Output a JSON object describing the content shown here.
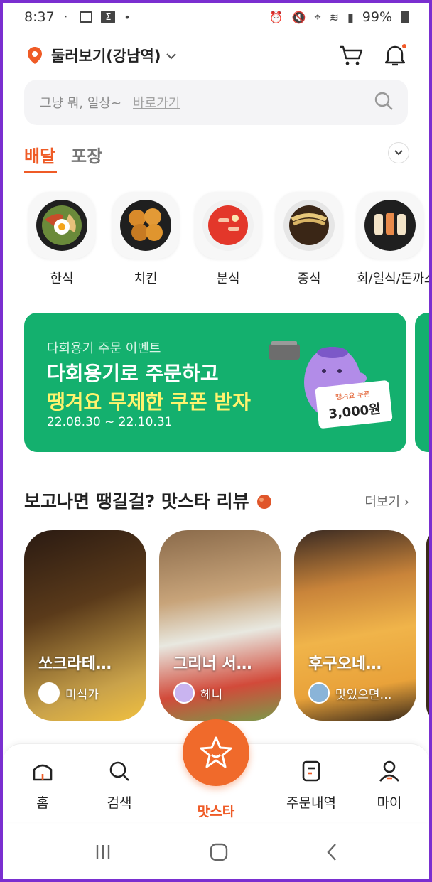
{
  "status_bar": {
    "time": "8:37",
    "battery": "99%"
  },
  "header": {
    "location": "둘러보기(강남역)"
  },
  "search": {
    "placeholder": "그냥 뭐, 일상~",
    "link": "바로가기"
  },
  "tabs": [
    {
      "label": "배달"
    },
    {
      "label": "포장"
    }
  ],
  "categories": [
    {
      "label": "한식"
    },
    {
      "label": "치킨"
    },
    {
      "label": "분식"
    },
    {
      "label": "중식"
    },
    {
      "label": "회/일식/돈까스"
    }
  ],
  "banner": {
    "subtitle": "다회용기 주문 이벤트",
    "title_line1": "다회용기로 주문하고",
    "title_line2": "땡겨요 무제한 쿠폰 받자",
    "dates": "22.08.30 ~ 22.10.31",
    "coupon_label": "땡겨요 쿠폰",
    "coupon_value": "3,000원"
  },
  "review_section": {
    "title": "보고나면 땡길걸? 맛스타 리뷰",
    "more": "더보기",
    "cards": [
      {
        "title": "쏘크라테…",
        "user": "미식가"
      },
      {
        "title": "그리너 서…",
        "user": "헤니"
      },
      {
        "title": "후구오네…",
        "user": "맛있으면…"
      }
    ]
  },
  "bottom_nav": [
    {
      "label": "홈"
    },
    {
      "label": "검색"
    },
    {
      "label": "맛스타"
    },
    {
      "label": "주문내역"
    },
    {
      "label": "마이"
    }
  ],
  "colors": {
    "accent": "#ef5b26",
    "banner_green": "#14b06e",
    "banner_yellow": "#fff36e"
  }
}
